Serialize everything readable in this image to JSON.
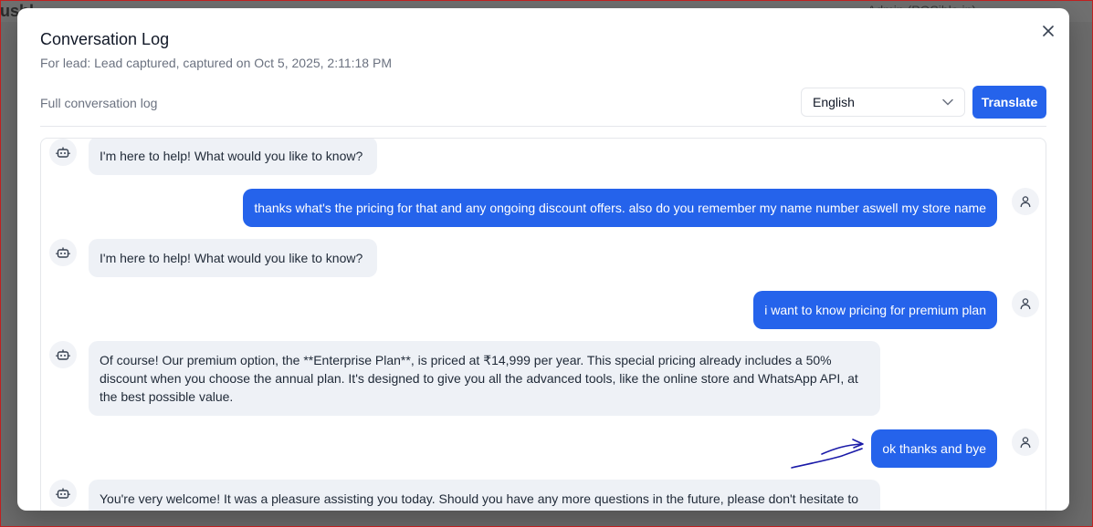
{
  "background": {
    "brand_fragment": "ushl",
    "admin_fragment": "Admin (POSible.in)"
  },
  "modal": {
    "title": "Conversation Log",
    "subtitle": "For lead: Lead captured, captured on Oct 5, 2025, 2:11:18 PM",
    "log_label": "Full conversation log",
    "language_selected": "English",
    "translate_label": "Translate",
    "close_icon": "close-icon"
  },
  "messages": [
    {
      "role": "bot",
      "text": "I'm here to help! What would you like to know?"
    },
    {
      "role": "user",
      "text": "thanks what's the pricing for that and any ongoing discount offers. also do you remember my name number aswell my store name"
    },
    {
      "role": "bot",
      "text": "I'm here to help! What would you like to know?"
    },
    {
      "role": "user",
      "text": "i want to know pricing for premium plan"
    },
    {
      "role": "bot",
      "text": "Of course! Our premium option, the **Enterprise Plan**, is priced at ₹14,999 per year. This special pricing already includes a 50% discount when you choose the annual plan. It's designed to give you all the advanced tools, like the online store and WhatsApp API, at the best possible value."
    },
    {
      "role": "user",
      "text": "ok thanks and bye"
    },
    {
      "role": "bot",
      "text": "You're very welcome! It was a pleasure assisting you today. Should you have any more questions in the future, please don't hesitate to"
    }
  ],
  "colors": {
    "accent": "#2563eb",
    "bot_bubble": "#eef1f6",
    "annotation": "#1a1aa8"
  }
}
